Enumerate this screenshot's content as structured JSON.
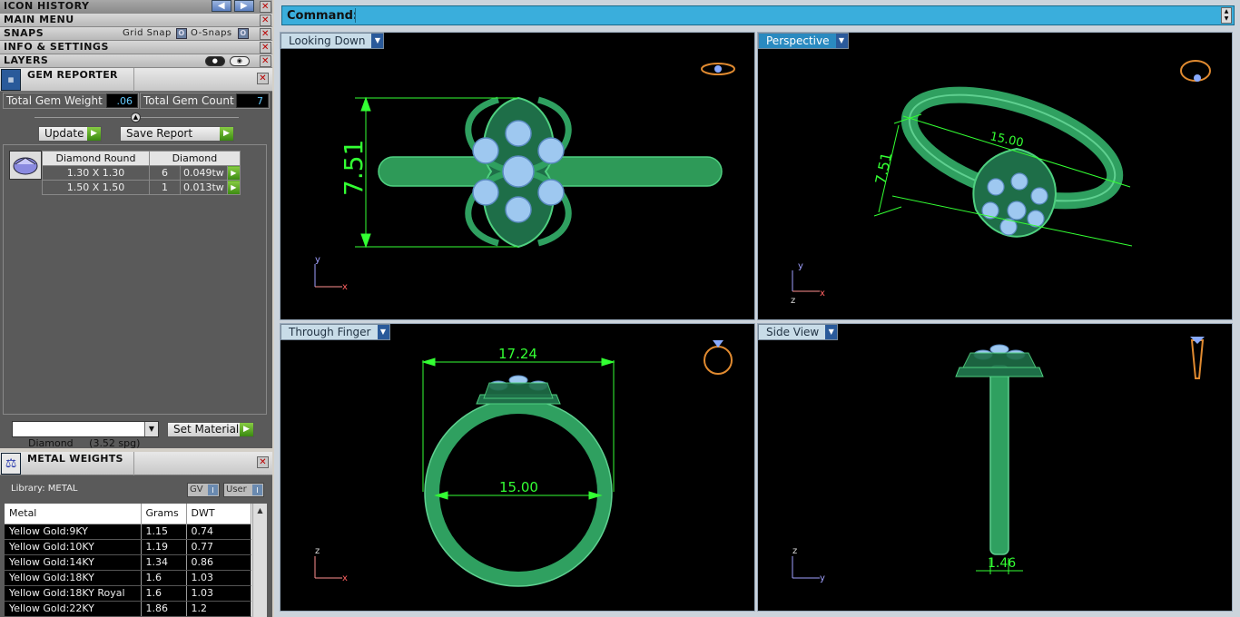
{
  "panels": {
    "icon_history": "ICON HISTORY",
    "main_menu": "MAIN MENU",
    "snaps": "SNAPS",
    "grid_snap": "Grid Snap",
    "o_snaps": "O-Snaps",
    "info_settings": "INFO & SETTINGS",
    "layers": "LAYERS"
  },
  "gem_reporter": {
    "title": "GEM REPORTER",
    "weight_label": "Total Gem Weight",
    "weight_value": ".06",
    "count_label": "Total Gem Count",
    "count_value": "7",
    "update_label": "Update",
    "save_label": "Save Report",
    "table_headers": [
      "Diamond Round",
      "Diamond"
    ],
    "rows": [
      {
        "size": "1.30 X 1.30",
        "count": "6",
        "weight": "0.049tw"
      },
      {
        "size": "1.50 X 1.50",
        "count": "1",
        "weight": "0.013tw"
      }
    ],
    "material_select": "Diamond     (3.52 spg)",
    "set_material": "Set Material"
  },
  "metal_weights": {
    "title": "METAL WEIGHTS",
    "library": "Library: METAL",
    "gv": "GV",
    "user": "User",
    "headers": [
      "Metal",
      "Grams",
      "DWT"
    ],
    "rows": [
      [
        "Yellow Gold:9KY",
        "1.15",
        "0.74"
      ],
      [
        "Yellow Gold:10KY",
        "1.19",
        "0.77"
      ],
      [
        "Yellow Gold:14KY",
        "1.34",
        "0.86"
      ],
      [
        "Yellow Gold:18KY",
        "1.6",
        "1.03"
      ],
      [
        "Yellow Gold:18KY Royal",
        "1.6",
        "1.03"
      ],
      [
        "Yellow Gold:22KY",
        "1.86",
        "1.2"
      ]
    ]
  },
  "command": {
    "label": "Command:",
    "value": ""
  },
  "viewports": {
    "top": {
      "label": "Looking Down",
      "dim": "7.51"
    },
    "persp": {
      "label": "Perspective",
      "dim1": "7.51",
      "dim2": "15.00"
    },
    "front": {
      "label": "Through Finger",
      "dim1": "17.24",
      "dim2": "15.00"
    },
    "side": {
      "label": "Side View",
      "dim": "1.46"
    }
  },
  "axes": {
    "x": "x",
    "y": "y",
    "z": "z"
  },
  "colors": {
    "ring": "#2fa060",
    "gem": "#9ec8f0",
    "dim": "#33ff33",
    "command": "#3aaedc"
  }
}
